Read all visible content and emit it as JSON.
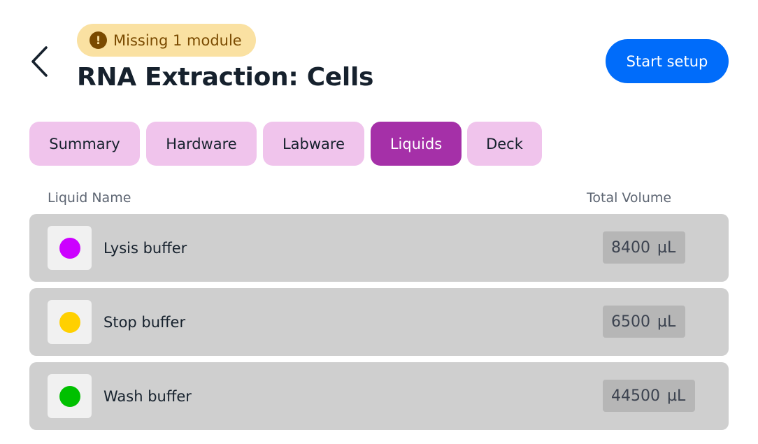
{
  "header": {
    "warning_badge": "Missing 1 module",
    "title": "RNA Extraction: Cells",
    "start_setup_label": "Start setup"
  },
  "tabs": [
    {
      "label": "Summary",
      "active": false
    },
    {
      "label": "Hardware",
      "active": false
    },
    {
      "label": "Labware",
      "active": false
    },
    {
      "label": "Liquids",
      "active": true
    },
    {
      "label": "Deck",
      "active": false
    }
  ],
  "table": {
    "col_liquid_name": "Liquid Name",
    "col_total_volume": "Total Volume",
    "rows": [
      {
        "name": "Lysis buffer",
        "volume": "8400",
        "unit": "µL",
        "color": "#cc00ff"
      },
      {
        "name": "Stop buffer",
        "volume": "6500",
        "unit": "µL",
        "color": "#ffd000"
      },
      {
        "name": "Wash buffer",
        "volume": "44500",
        "unit": "µL",
        "color": "#00c000"
      }
    ]
  },
  "colors": {
    "primary": "#006cfa",
    "tab_active": "#a530a8",
    "tab_inactive": "#f0c4ec",
    "warning_bg": "#fae1a2",
    "row_bg": "#cfcfcf"
  },
  "icons": {
    "back": "chevron-left-icon",
    "warning": "alert-circle-icon"
  }
}
